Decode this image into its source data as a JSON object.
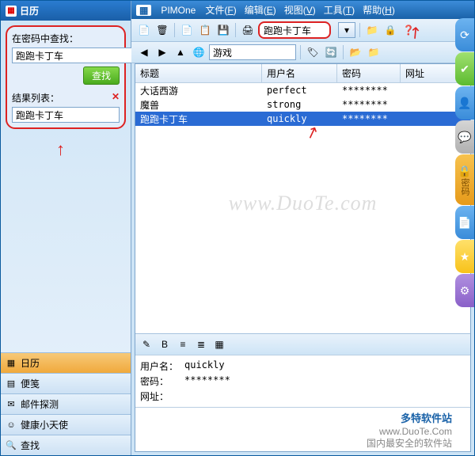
{
  "sidebar": {
    "title": "日历",
    "search_label": "在密码中查找：",
    "search_value": "跑跑卡丁车",
    "find_btn": "查找",
    "result_label": "结果列表：",
    "result_value": "跑跑卡丁车",
    "footer": [
      {
        "icon": "📅",
        "label": "日历",
        "name": "nav-calendar"
      },
      {
        "icon": "📝",
        "label": "便笺",
        "name": "nav-notes"
      },
      {
        "icon": "✉",
        "label": "邮件探测",
        "name": "nav-mail"
      },
      {
        "icon": "👼",
        "label": "健康小天使",
        "name": "nav-health"
      },
      {
        "icon": "🔍",
        "label": "查找",
        "name": "nav-find"
      }
    ]
  },
  "titlebar": {
    "app": "PIMOne",
    "menus": [
      {
        "label": "文件",
        "key": "F"
      },
      {
        "label": "编辑",
        "key": "E"
      },
      {
        "label": "视图",
        "key": "V"
      },
      {
        "label": "工具",
        "key": "T"
      },
      {
        "label": "帮助",
        "key": "H"
      }
    ]
  },
  "toolbar": {
    "search_value": "跑跑卡丁车",
    "path_value": "游戏"
  },
  "grid": {
    "headers": [
      "标题",
      "用户名",
      "密码",
      "网址"
    ],
    "rows": [
      {
        "title": "大话西游",
        "user": "perfect",
        "pass": "********",
        "url": ""
      },
      {
        "title": "魔兽",
        "user": "strong",
        "pass": "********",
        "url": ""
      },
      {
        "title": "跑跑卡丁车",
        "user": "quickly",
        "pass": "********",
        "url": "",
        "selected": true
      }
    ]
  },
  "detail": {
    "user_label": "用户名：",
    "user_value": "quickly",
    "pass_label": "密码：",
    "pass_value": "********",
    "url_label": "网址："
  },
  "rail": {
    "password_label": "密码"
  },
  "watermark": "www.DuoTe.com",
  "footer": {
    "line1": "多特软件站",
    "line2": "www.DuoTe.Com",
    "line3": "国内最安全的软件站"
  }
}
